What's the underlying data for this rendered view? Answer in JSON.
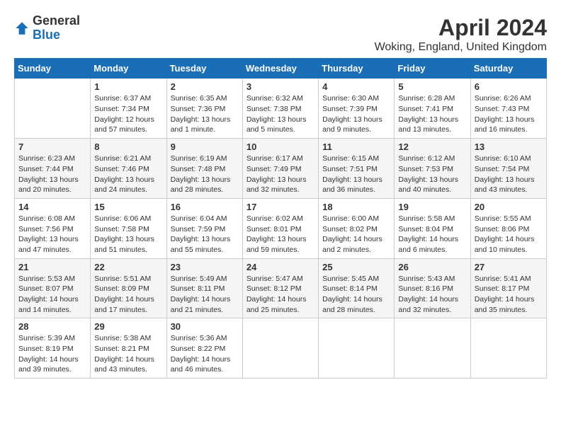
{
  "logo": {
    "general": "General",
    "blue": "Blue"
  },
  "title": "April 2024",
  "subtitle": "Woking, England, United Kingdom",
  "calendar": {
    "headers": [
      "Sunday",
      "Monday",
      "Tuesday",
      "Wednesday",
      "Thursday",
      "Friday",
      "Saturday"
    ],
    "weeks": [
      [
        {
          "day": "",
          "detail": ""
        },
        {
          "day": "1",
          "detail": "Sunrise: 6:37 AM\nSunset: 7:34 PM\nDaylight: 12 hours\nand 57 minutes."
        },
        {
          "day": "2",
          "detail": "Sunrise: 6:35 AM\nSunset: 7:36 PM\nDaylight: 13 hours\nand 1 minute."
        },
        {
          "day": "3",
          "detail": "Sunrise: 6:32 AM\nSunset: 7:38 PM\nDaylight: 13 hours\nand 5 minutes."
        },
        {
          "day": "4",
          "detail": "Sunrise: 6:30 AM\nSunset: 7:39 PM\nDaylight: 13 hours\nand 9 minutes."
        },
        {
          "day": "5",
          "detail": "Sunrise: 6:28 AM\nSunset: 7:41 PM\nDaylight: 13 hours\nand 13 minutes."
        },
        {
          "day": "6",
          "detail": "Sunrise: 6:26 AM\nSunset: 7:43 PM\nDaylight: 13 hours\nand 16 minutes."
        }
      ],
      [
        {
          "day": "7",
          "detail": "Sunrise: 6:23 AM\nSunset: 7:44 PM\nDaylight: 13 hours\nand 20 minutes."
        },
        {
          "day": "8",
          "detail": "Sunrise: 6:21 AM\nSunset: 7:46 PM\nDaylight: 13 hours\nand 24 minutes."
        },
        {
          "day": "9",
          "detail": "Sunrise: 6:19 AM\nSunset: 7:48 PM\nDaylight: 13 hours\nand 28 minutes."
        },
        {
          "day": "10",
          "detail": "Sunrise: 6:17 AM\nSunset: 7:49 PM\nDaylight: 13 hours\nand 32 minutes."
        },
        {
          "day": "11",
          "detail": "Sunrise: 6:15 AM\nSunset: 7:51 PM\nDaylight: 13 hours\nand 36 minutes."
        },
        {
          "day": "12",
          "detail": "Sunrise: 6:12 AM\nSunset: 7:53 PM\nDaylight: 13 hours\nand 40 minutes."
        },
        {
          "day": "13",
          "detail": "Sunrise: 6:10 AM\nSunset: 7:54 PM\nDaylight: 13 hours\nand 43 minutes."
        }
      ],
      [
        {
          "day": "14",
          "detail": "Sunrise: 6:08 AM\nSunset: 7:56 PM\nDaylight: 13 hours\nand 47 minutes."
        },
        {
          "day": "15",
          "detail": "Sunrise: 6:06 AM\nSunset: 7:58 PM\nDaylight: 13 hours\nand 51 minutes."
        },
        {
          "day": "16",
          "detail": "Sunrise: 6:04 AM\nSunset: 7:59 PM\nDaylight: 13 hours\nand 55 minutes."
        },
        {
          "day": "17",
          "detail": "Sunrise: 6:02 AM\nSunset: 8:01 PM\nDaylight: 13 hours\nand 59 minutes."
        },
        {
          "day": "18",
          "detail": "Sunrise: 6:00 AM\nSunset: 8:02 PM\nDaylight: 14 hours\nand 2 minutes."
        },
        {
          "day": "19",
          "detail": "Sunrise: 5:58 AM\nSunset: 8:04 PM\nDaylight: 14 hours\nand 6 minutes."
        },
        {
          "day": "20",
          "detail": "Sunrise: 5:55 AM\nSunset: 8:06 PM\nDaylight: 14 hours\nand 10 minutes."
        }
      ],
      [
        {
          "day": "21",
          "detail": "Sunrise: 5:53 AM\nSunset: 8:07 PM\nDaylight: 14 hours\nand 14 minutes."
        },
        {
          "day": "22",
          "detail": "Sunrise: 5:51 AM\nSunset: 8:09 PM\nDaylight: 14 hours\nand 17 minutes."
        },
        {
          "day": "23",
          "detail": "Sunrise: 5:49 AM\nSunset: 8:11 PM\nDaylight: 14 hours\nand 21 minutes."
        },
        {
          "day": "24",
          "detail": "Sunrise: 5:47 AM\nSunset: 8:12 PM\nDaylight: 14 hours\nand 25 minutes."
        },
        {
          "day": "25",
          "detail": "Sunrise: 5:45 AM\nSunset: 8:14 PM\nDaylight: 14 hours\nand 28 minutes."
        },
        {
          "day": "26",
          "detail": "Sunrise: 5:43 AM\nSunset: 8:16 PM\nDaylight: 14 hours\nand 32 minutes."
        },
        {
          "day": "27",
          "detail": "Sunrise: 5:41 AM\nSunset: 8:17 PM\nDaylight: 14 hours\nand 35 minutes."
        }
      ],
      [
        {
          "day": "28",
          "detail": "Sunrise: 5:39 AM\nSunset: 8:19 PM\nDaylight: 14 hours\nand 39 minutes."
        },
        {
          "day": "29",
          "detail": "Sunrise: 5:38 AM\nSunset: 8:21 PM\nDaylight: 14 hours\nand 43 minutes."
        },
        {
          "day": "30",
          "detail": "Sunrise: 5:36 AM\nSunset: 8:22 PM\nDaylight: 14 hours\nand 46 minutes."
        },
        {
          "day": "",
          "detail": ""
        },
        {
          "day": "",
          "detail": ""
        },
        {
          "day": "",
          "detail": ""
        },
        {
          "day": "",
          "detail": ""
        }
      ]
    ]
  }
}
